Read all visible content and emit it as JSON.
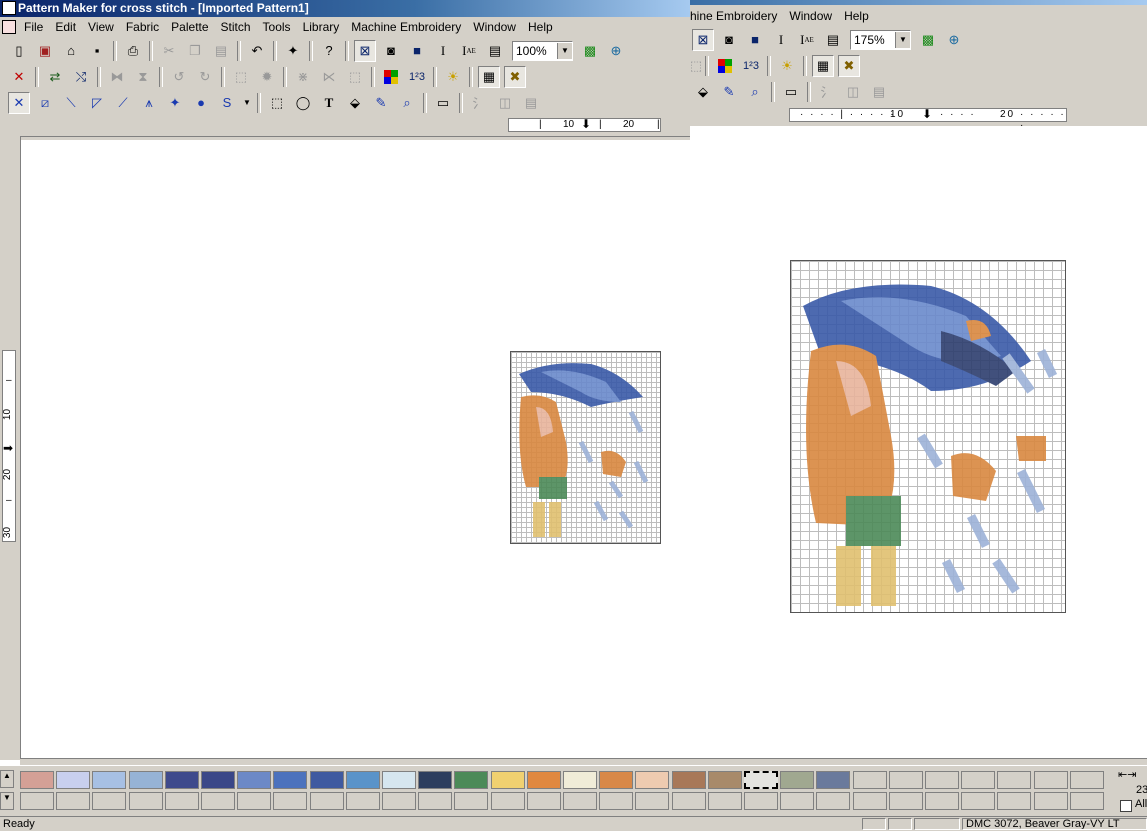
{
  "left_window": {
    "title": "Pattern Maker for cross stitch - [Imported Pattern1]",
    "menu": [
      "File",
      "Edit",
      "View",
      "Fabric",
      "Palette",
      "Stitch",
      "Tools",
      "Library",
      "Machine Embroidery",
      "Window",
      "Help"
    ],
    "zoom": "100%",
    "ruler_h_ticks": [
      "10",
      "20"
    ],
    "ruler_v_ticks": [
      "10",
      "20",
      "30"
    ]
  },
  "right_window": {
    "menu": [
      "hine Embroidery",
      "Window",
      "Help"
    ],
    "zoom": "175%",
    "ruler_h_ticks": [
      "10",
      "20"
    ]
  },
  "icons": {
    "toolbar1": [
      "new-icon",
      "import-icon",
      "open-icon",
      "save-icon",
      "print-icon",
      "cut-icon",
      "copy-icon",
      "paste-icon",
      "undo-icon",
      "wizard-icon",
      "help-icon",
      "full-stitch-view-icon",
      "symbol-view-icon",
      "block-view-icon",
      "italic-icon",
      "font-icon",
      "notes-icon",
      "fit-icon",
      "zoom-fit-icon"
    ],
    "toolbar2": [
      "delete-icon",
      "swap-icon",
      "replace-icon",
      "flip-h-icon",
      "flip-v-icon",
      "rotate-left-icon",
      "rotate-right-icon",
      "select-area-icon",
      "fill-area-icon",
      "mirror-icon",
      "mirror-2-icon",
      "frame-icon",
      "palette-icon",
      "numbers-icon",
      "sun-icon",
      "grid-icon",
      "cross-icon"
    ],
    "toolbar3": [
      "full-stitch-icon",
      "half-stitch-icon",
      "quarter-stitch-icon",
      "three-quarter-stitch-icon",
      "backstitch-icon",
      "french-knot-icon",
      "bead-icon",
      "stitch-s-icon",
      "rect-select-icon",
      "lasso-icon",
      "text-icon",
      "fill-icon",
      "eyedropper-icon",
      "magnifier-icon",
      "machine-icon",
      "erase-icon",
      "split-icon",
      "pages-icon"
    ]
  },
  "palette": {
    "colors": [
      "#d4a096",
      "#c8cfee",
      "#a7c0e4",
      "#96b3d6",
      "#3e4a8c",
      "#3a4788",
      "#6c89c7",
      "#4c72bd",
      "#3f5aa0",
      "#5a93c9",
      "#d6e6ef",
      "#2d3e5e",
      "#4c8a58",
      "#f0d070",
      "#e08840",
      "#f0ecd8",
      "#d88848",
      "#eecbb0",
      "#a87858",
      "#a88a6a",
      "#e4e4e0",
      "#a0a890",
      "#6a7a9c",
      "#d4d0c8",
      "#d4d0c8",
      "#d4d0c8",
      "#d4d0c8",
      "#d4d0c8",
      "#d4d0c8",
      "#d4d0c8"
    ],
    "page_number": "23",
    "all_label": "All"
  },
  "status": {
    "left": "Ready",
    "color_info": "DMC  3072, Beaver Gray-VY LT"
  }
}
